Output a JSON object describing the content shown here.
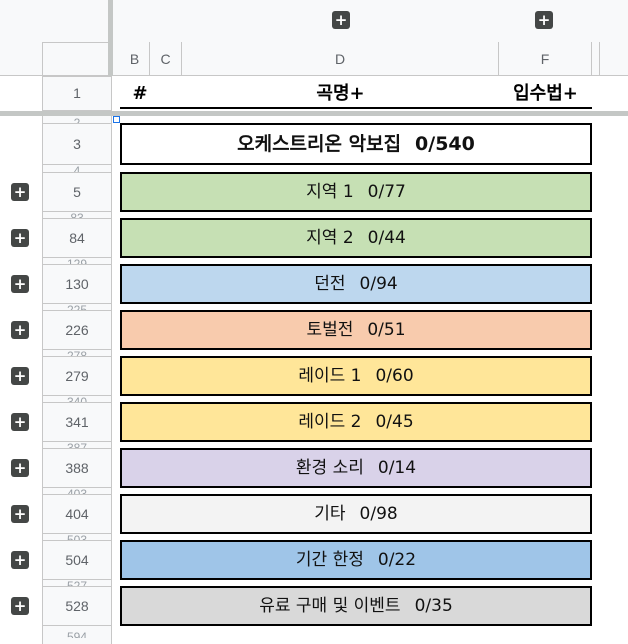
{
  "columns": [
    "B",
    "C",
    "D",
    "F"
  ],
  "header_row": {
    "row": "1",
    "num_label": "#",
    "song_label": "곡명+",
    "acquire_label": "입수법+"
  },
  "hidden_row_numbers": [
    "2",
    "4",
    "83",
    "129",
    "225",
    "278",
    "340",
    "387",
    "403",
    "503",
    "527",
    "594"
  ],
  "sections": [
    {
      "row": "3",
      "label": "오케스트리온 악보집",
      "count": "0/540",
      "color": "#ffffff"
    },
    {
      "row": "5",
      "label": "지역 1",
      "count": "0/77",
      "color": "#c6e0b4"
    },
    {
      "row": "84",
      "label": "지역 2",
      "count": "0/44",
      "color": "#c6e0b4"
    },
    {
      "row": "130",
      "label": "던전",
      "count": "0/94",
      "color": "#bdd7ee"
    },
    {
      "row": "226",
      "label": "토벌전",
      "count": "0/51",
      "color": "#f8cbad"
    },
    {
      "row": "279",
      "label": "레이드 1",
      "count": "0/60",
      "color": "#ffe699"
    },
    {
      "row": "341",
      "label": "레이드 2",
      "count": "0/45",
      "color": "#ffe699"
    },
    {
      "row": "388",
      "label": "환경 소리",
      "count": "0/14",
      "color": "#d9d2e9"
    },
    {
      "row": "404",
      "label": "기타",
      "count": "0/98",
      "color": "#f3f3f3"
    },
    {
      "row": "504",
      "label": "기간 한정",
      "count": "0/22",
      "color": "#9fc5e8"
    },
    {
      "row": "528",
      "label": "유료 구매 및 이벤트",
      "count": "0/35",
      "color": "#d9d9d9"
    }
  ],
  "icons": {
    "expand": "plus-icon"
  }
}
